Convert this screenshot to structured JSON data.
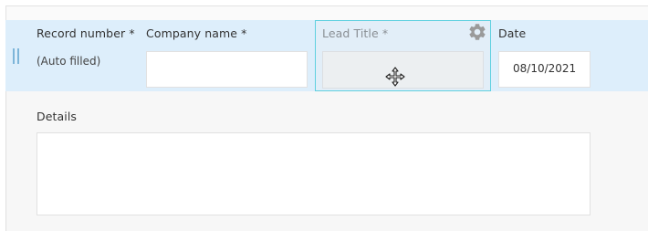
{
  "form": {
    "record_number": {
      "label": "Record number *",
      "value": "(Auto filled)"
    },
    "company_name": {
      "label": "Company name *",
      "value": ""
    },
    "lead_title": {
      "label": "Lead Title *",
      "value": ""
    },
    "date": {
      "label": "Date",
      "value": "08/10/2021"
    },
    "details": {
      "label": "Details",
      "value": ""
    }
  },
  "icons": {
    "settings": "gear-icon",
    "drag_handle": "drag-handle-icon",
    "cursor": "move-cursor-icon"
  },
  "colors": {
    "row_highlight": "#ddeefb",
    "selected_field_border": "#5fd0e0",
    "gear": "#9a9a9a"
  }
}
